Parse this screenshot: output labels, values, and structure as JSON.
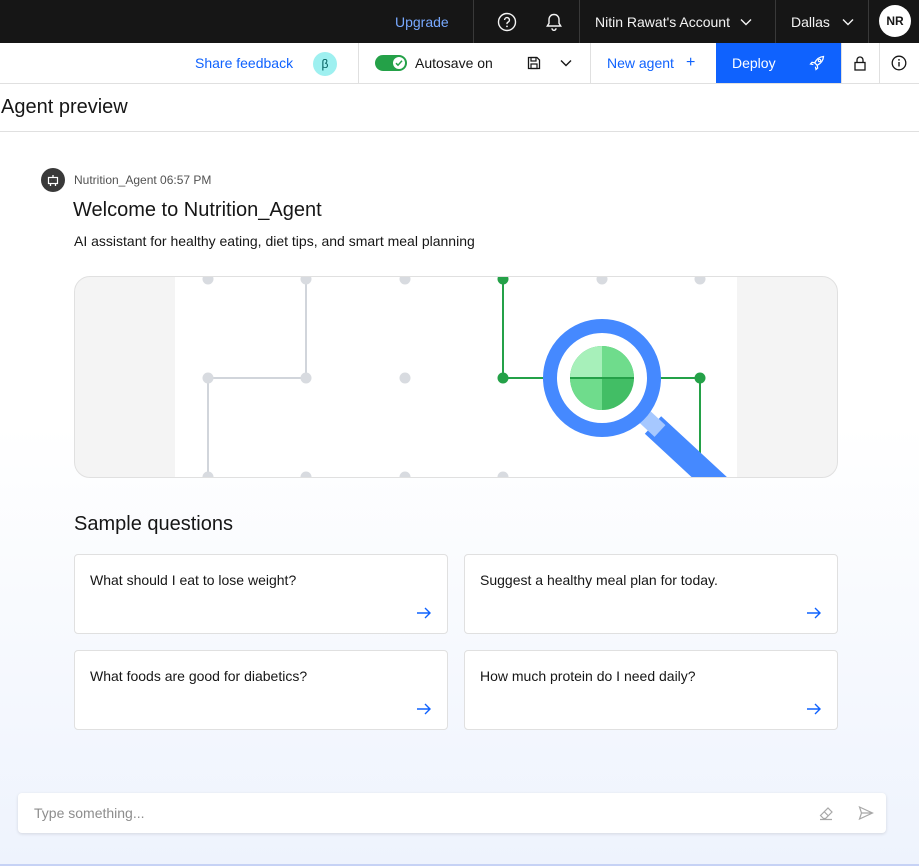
{
  "topbar": {
    "upgrade_label": "Upgrade",
    "account_label": "Nitin Rawat's Account",
    "region_label": "Dallas",
    "avatar_initials": "NR"
  },
  "toolbar": {
    "share_feedback_label": "Share feedback",
    "beta_label": "β",
    "autosave_label": "Autosave on",
    "autosave_on": true,
    "new_agent_label": "New agent",
    "deploy_label": "Deploy"
  },
  "page": {
    "title": "Agent preview"
  },
  "message": {
    "sender": "Nutrition_Agent",
    "time": "06:57 PM",
    "meta": "Nutrition_Agent 06:57 PM",
    "welcome": "Welcome to Nutrition_Agent",
    "description": "AI assistant for healthy eating, diet tips, and smart meal planning"
  },
  "sample_questions": {
    "title": "Sample questions",
    "items": [
      {
        "text": "What should I eat to lose weight?"
      },
      {
        "text": "Suggest a healthy meal plan for today."
      },
      {
        "text": "What foods are good for diabetics?"
      },
      {
        "text": "How much protein do I need daily?"
      }
    ]
  },
  "chat_input": {
    "placeholder": "Type something...",
    "value": ""
  },
  "colors": {
    "accent": "#0f62fe",
    "topbar_bg": "#161616",
    "toggle_on": "#24a148",
    "illustration_green": "#24a148",
    "illustration_blue": "#4589ff"
  },
  "icons": {
    "help": "help-circle-icon",
    "notifications": "bell-icon",
    "save": "floppy-disk-icon",
    "deploy": "rocket-icon",
    "lock": "lock-icon",
    "info": "info-circle-icon",
    "bot": "robot-icon",
    "arrow": "arrow-right-icon",
    "clear": "eraser-icon",
    "send": "send-icon"
  }
}
